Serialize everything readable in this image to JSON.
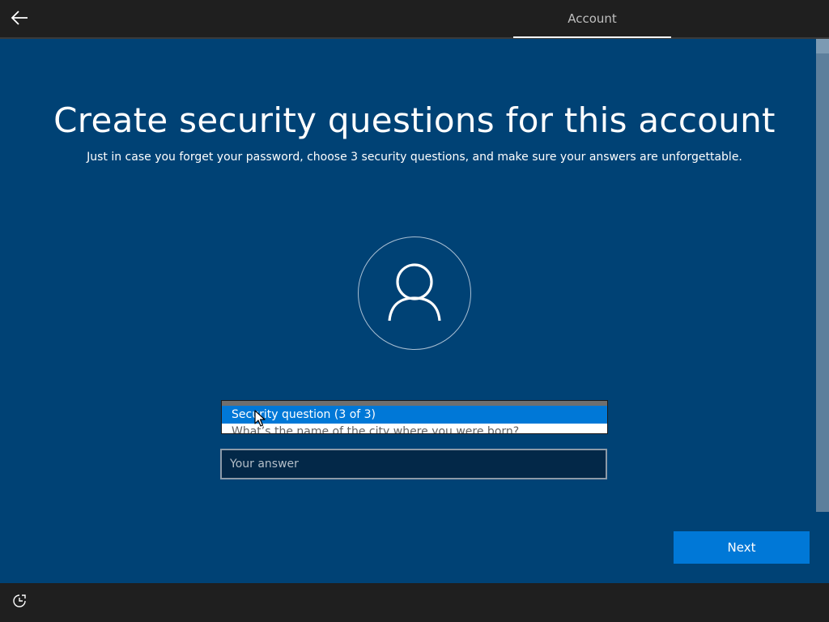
{
  "header": {
    "back_icon": "arrow-left-icon",
    "tab_label": "Account"
  },
  "main": {
    "title": "Create security questions for this account",
    "subtitle": "Just in case you forget your password, choose 3 security questions, and make sure your answers are unforgettable.",
    "avatar_icon": "person-icon",
    "dropdown": {
      "selected": "Security question (3 of 3)",
      "options": [
        "What’s the name of the city where you were born?"
      ]
    },
    "answer": {
      "placeholder": "Your answer",
      "value": ""
    },
    "next_label": "Next"
  },
  "footer": {
    "accessibility_icon": "ease-of-access-icon"
  },
  "colors": {
    "background": "#004275",
    "accent": "#0078d7",
    "bar": "#1f1f1f"
  }
}
